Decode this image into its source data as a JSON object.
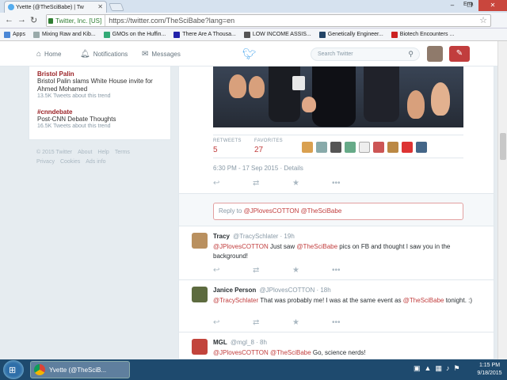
{
  "browser": {
    "tab_title": "Yvette (@TheSciBabe) | Tw",
    "user_name": "Ena",
    "ev_label": "Twitter, Inc. [US]",
    "url": "https://twitter.com/TheSciBabe?lang=en",
    "bookmarks": [
      {
        "label": "Apps",
        "color": "#4a87d6"
      },
      {
        "label": "Mixing Raw and Kib...",
        "color": "#9aa"
      },
      {
        "label": "GMOs on the Huffin...",
        "color": "#3a7"
      },
      {
        "label": "There Are A Thousa...",
        "color": "#22a"
      },
      {
        "label": "LOW INCOME ASSIS...",
        "color": "#555"
      },
      {
        "label": "Genetically Engineer...",
        "color": "#246"
      },
      {
        "label": "Biotech Encounters ...",
        "color": "#c22"
      }
    ]
  },
  "twitter_nav": {
    "home": "Home",
    "notifications": "Notifications",
    "messages": "Messages",
    "search_placeholder": "Search Twitter"
  },
  "trends": [
    {
      "title": "Bristol Palin",
      "desc": "Bristol Palin slams White House invite for Ahmed Mohamed",
      "count": "13.5K Tweets about this trend"
    },
    {
      "title": "#cnndebate",
      "desc": "Post-CNN Debate Thoughts",
      "count": "16.5K Tweets about this trend"
    }
  ],
  "footer": {
    "line1": [
      "© 2015 Twitter",
      "About",
      "Help",
      "Terms"
    ],
    "line2": [
      "Privacy",
      "Cookies",
      "Ads info"
    ]
  },
  "tweet": {
    "retweets_label": "RETWEETS",
    "retweets": "5",
    "favorites_label": "FAVORITES",
    "favorites": "27",
    "time": "6:30 PM - 17 Sep 2015",
    "details": "Details"
  },
  "reply_box": {
    "prefix": "Reply to ",
    "mentions": "@JPlovesCOTTON @TheSciBabe"
  },
  "replies": [
    {
      "name": "Tracy",
      "handle": "@TracySchlater · 19h",
      "mention": "@JPlovesCOTTON",
      "text1": " Just saw ",
      "mention2": "@TheSciBabe",
      "text2": " pics on FB and thought I saw you in the background!",
      "avatar_color": "#b9905f"
    },
    {
      "name": "Janice Person",
      "handle": "@JPlovesCOTTON · 18h",
      "mention": "@TracySchlater",
      "text1": " That was probably me! I was at the same event as ",
      "mention2": "@TheSciBabe",
      "text2": " tonight. :)",
      "avatar_color": "#5d6b3f"
    },
    {
      "name": "MGL",
      "handle": "@mgl_8 · 8h",
      "mention": "@JPlovesCOTTON",
      "text1": " ",
      "mention2": "@TheSciBabe",
      "text2": " Go, science nerds!",
      "avatar_color": "#c2443c"
    }
  ],
  "taskbar": {
    "chrome_label": "Yvette (@TheSciB...",
    "time": "1:15 PM",
    "date": "9/18/2015"
  }
}
